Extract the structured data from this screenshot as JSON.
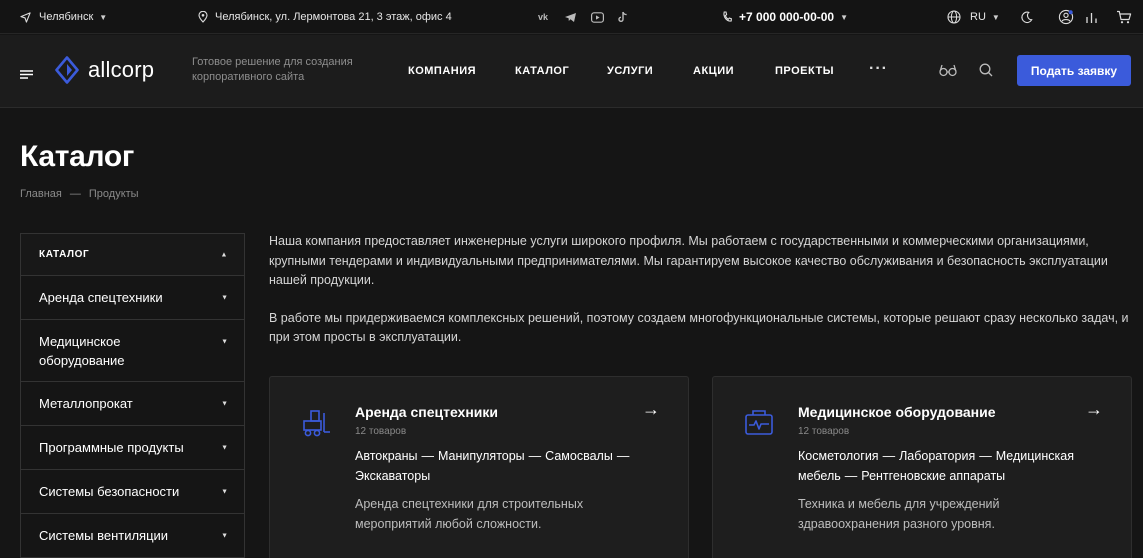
{
  "topbar": {
    "city": "Челябинск",
    "address": "Челябинск, ул. Лермонтова 21, 3 этаж, офис 4",
    "social_icons": [
      "vk-icon",
      "telegram-icon",
      "youtube-icon",
      "tiktok-icon"
    ],
    "phone": "+7 000 000-00-00",
    "language": "RU"
  },
  "header": {
    "logo_text": "allcorp",
    "slogan": "Готовое решение для создания корпоративного сайта",
    "nav": [
      "КОМПАНИЯ",
      "КАТАЛОГ",
      "УСЛУГИ",
      "АКЦИИ",
      "ПРОЕКТЫ"
    ],
    "more": "···",
    "cta": "Подать заявку"
  },
  "page": {
    "title": "Каталог",
    "breadcrumb": [
      "Главная",
      "—",
      "Продукты"
    ]
  },
  "sidebar": {
    "heading": "КАТАЛОГ",
    "items": [
      "Аренда спецтехники",
      "Медицинское оборудование",
      "Металлопрокат",
      "Программные продукты",
      "Системы безопасности",
      "Системы вентиляции"
    ]
  },
  "intro": {
    "p1": "Наша компания предоставляет инженерные услуги широкого профиля. Мы работаем с государственными и коммерческими организациями, крупными тендерами и индивидуальными предпринимателями. Мы гарантируем высокое качество обслуживания и безопасность эксплуатации нашей продукции.",
    "p2": "В работе мы придерживаемся комплексных решений, поэтому создаем многофункциональные системы, которые решают сразу несколько задач, и при этом просты в эксплуатации."
  },
  "cards": [
    {
      "title": "Аренда спецтехники",
      "count": "12 товаров",
      "links": [
        "Автокраны",
        "Манипуляторы",
        "Самосвалы",
        "Экскаваторы"
      ],
      "description": "Аренда спецтехники для строительных мероприятий любой сложности."
    },
    {
      "title": "Медицинское оборудование",
      "count": "12 товаров",
      "links": [
        "Косметология",
        "Лаборатория",
        "Медицинская мебель",
        "Рентгеновские аппараты"
      ],
      "description": "Техника и мебель для учреждений здравоохранения разного уровня."
    }
  ],
  "colors": {
    "accent": "#3b5bdb",
    "background": "#151515",
    "header_bg": "#1c1c1c",
    "card_bg": "#1e1e1e"
  }
}
